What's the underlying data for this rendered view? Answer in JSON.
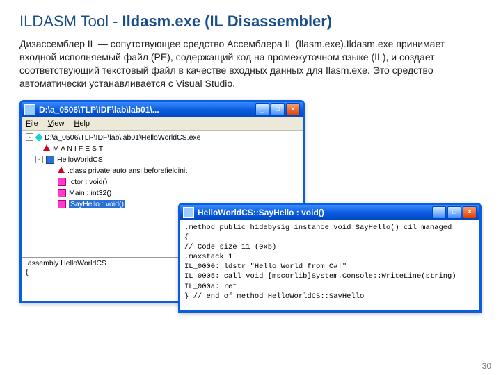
{
  "title_plain": "ILDASM Tool - ",
  "title_bold": "Ildasm.exe (IL Disassembler)",
  "description": "Дизассемблер IL — сопутствующее средство Ассемблера IL (Ilasm.exe).Ildasm.exe принимает входной исполняемый файл (PE), содержащий код на промежуточном языке (IL), и создает соответствующий текстовый файл в качестве входных данных для Ilasm.exe.\nЭто средство автоматически устанавливается с Visual Studio.",
  "win1": {
    "title": "D:\\a_0506\\TLP\\IDF\\lab\\lab01\\...",
    "menu": {
      "file": "File",
      "view": "View",
      "help": "Help"
    },
    "root": "D:\\a_0506\\TLP\\IDF\\lab\\lab01\\HelloWorldCS.exe",
    "manifest": "M A N I F E S T",
    "class": "HelloWorldCS",
    "members": {
      "classdef": ".class private auto ansi beforefieldinit",
      "ctor": ".ctor : void()",
      "main": "Main : int32()",
      "sayhello": "SayHello : void()"
    },
    "bottom1": ".assembly HelloWorldCS",
    "bottom2": "{"
  },
  "win2": {
    "title": "HelloWorldCS::SayHello : void()",
    "lines": [
      ".method public hidebysig instance void  SayHello() cil managed",
      "{",
      "  // Code size       11 (0xb)",
      "  .maxstack  1",
      "  IL_0000:  ldstr      \"Hello World from C#!\"",
      "  IL_0005:  call       void [mscorlib]System.Console::WriteLine(string)",
      "  IL_000a:  ret",
      "} // end of method HelloWorldCS::SayHello"
    ]
  },
  "pagenum": "30",
  "btn": {
    "min": "_",
    "max": "□",
    "close": "×"
  }
}
